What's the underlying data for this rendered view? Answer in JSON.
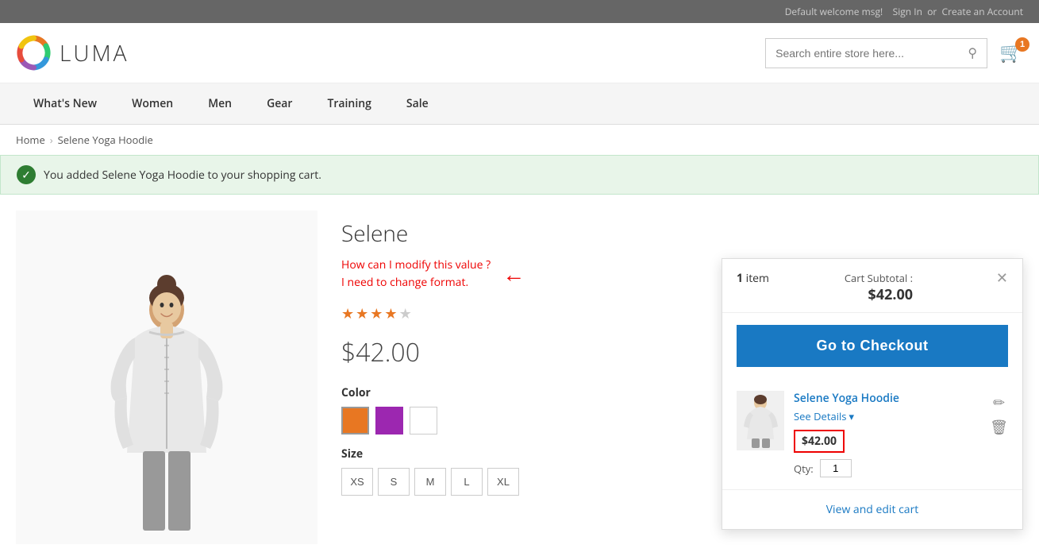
{
  "topbar": {
    "welcome": "Default welcome msg!",
    "signin": "Sign In",
    "or": "or",
    "create_account": "Create an Account"
  },
  "header": {
    "logo_text": "LUMA",
    "search_placeholder": "Search entire store here...",
    "cart_count": "1"
  },
  "nav": {
    "items": [
      {
        "label": "What's New",
        "id": "whats-new"
      },
      {
        "label": "Women",
        "id": "women"
      },
      {
        "label": "Men",
        "id": "men"
      },
      {
        "label": "Gear",
        "id": "gear"
      },
      {
        "label": "Training",
        "id": "training"
      },
      {
        "label": "Sale",
        "id": "sale"
      }
    ]
  },
  "breadcrumb": {
    "home": "Home",
    "current": "Selene Yoga Hoodie"
  },
  "success_message": "You added Selene Yoga Hoodie to your shopping cart.",
  "product": {
    "title": "Selene",
    "price": "$42.00",
    "annotation_line1": "How can I modify this value ?",
    "annotation_line2": "I need to change format.",
    "stars_filled": 4,
    "stars_empty": 1,
    "color_label": "Color",
    "colors": [
      "#e87722",
      "#9c27b0",
      "#ffffff"
    ],
    "size_label": "Size",
    "sizes": [
      "XS",
      "S",
      "M",
      "L",
      "XL"
    ]
  },
  "cart_dropdown": {
    "item_count": "1",
    "item_word": "item",
    "subtotal_label": "Cart Subtotal :",
    "subtotal_value": "$42.00",
    "checkout_btn": "Go to Checkout",
    "item_name": "Selene Yoga Hoodie",
    "see_details": "See Details",
    "item_price": "$42.00",
    "qty_label": "Qty:",
    "qty_value": "1",
    "view_edit_label": "View and edit cart"
  }
}
